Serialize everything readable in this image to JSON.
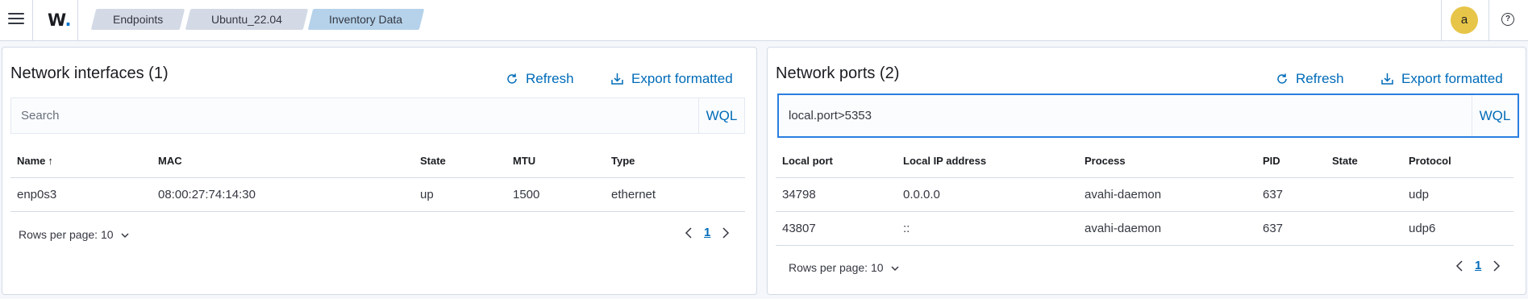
{
  "header": {
    "logo": "W",
    "breadcrumbs": [
      "Endpoints",
      "Ubuntu_22.04",
      "Inventory Data"
    ],
    "avatar_initial": "a",
    "help_symbol": "?"
  },
  "interfaces": {
    "title": "Network interfaces (1)",
    "refresh_label": "Refresh",
    "export_label": "Export formatted",
    "search_placeholder": "Search",
    "wql_label": "WQL",
    "columns": [
      "Name",
      "MAC",
      "State",
      "MTU",
      "Type"
    ],
    "sort_indicator": "↑",
    "rows": [
      {
        "name": "enp0s3",
        "mac": "08:00:27:74:14:30",
        "state": "up",
        "mtu": "1500",
        "type": "ethernet"
      }
    ],
    "rows_per_page": "Rows per page: 10",
    "page": "1"
  },
  "ports": {
    "title": "Network ports (2)",
    "refresh_label": "Refresh",
    "export_label": "Export formatted",
    "search_value": "local.port>5353",
    "wql_label": "WQL",
    "columns": [
      "Local port",
      "Local IP address",
      "Process",
      "PID",
      "State",
      "Protocol"
    ],
    "rows": [
      {
        "local_port": "34798",
        "local_ip": "0.0.0.0",
        "process": "avahi-daemon",
        "pid": "637",
        "state": "",
        "protocol": "udp"
      },
      {
        "local_port": "43807",
        "local_ip": "::",
        "process": "avahi-daemon",
        "pid": "637",
        "state": "",
        "protocol": "udp6"
      }
    ],
    "rows_per_page": "Rows per page: 10",
    "page": "1"
  },
  "icons": [
    "menu-icon",
    "refresh-icon",
    "export-icon",
    "chevron-down-icon",
    "chevron-left-icon",
    "chevron-right-icon",
    "help-icon"
  ],
  "colors": {
    "accent": "#006bb8",
    "active_crumb": "#b5d2ea",
    "avatar": "#e7c548",
    "focus_border": "#2a7ee0"
  }
}
